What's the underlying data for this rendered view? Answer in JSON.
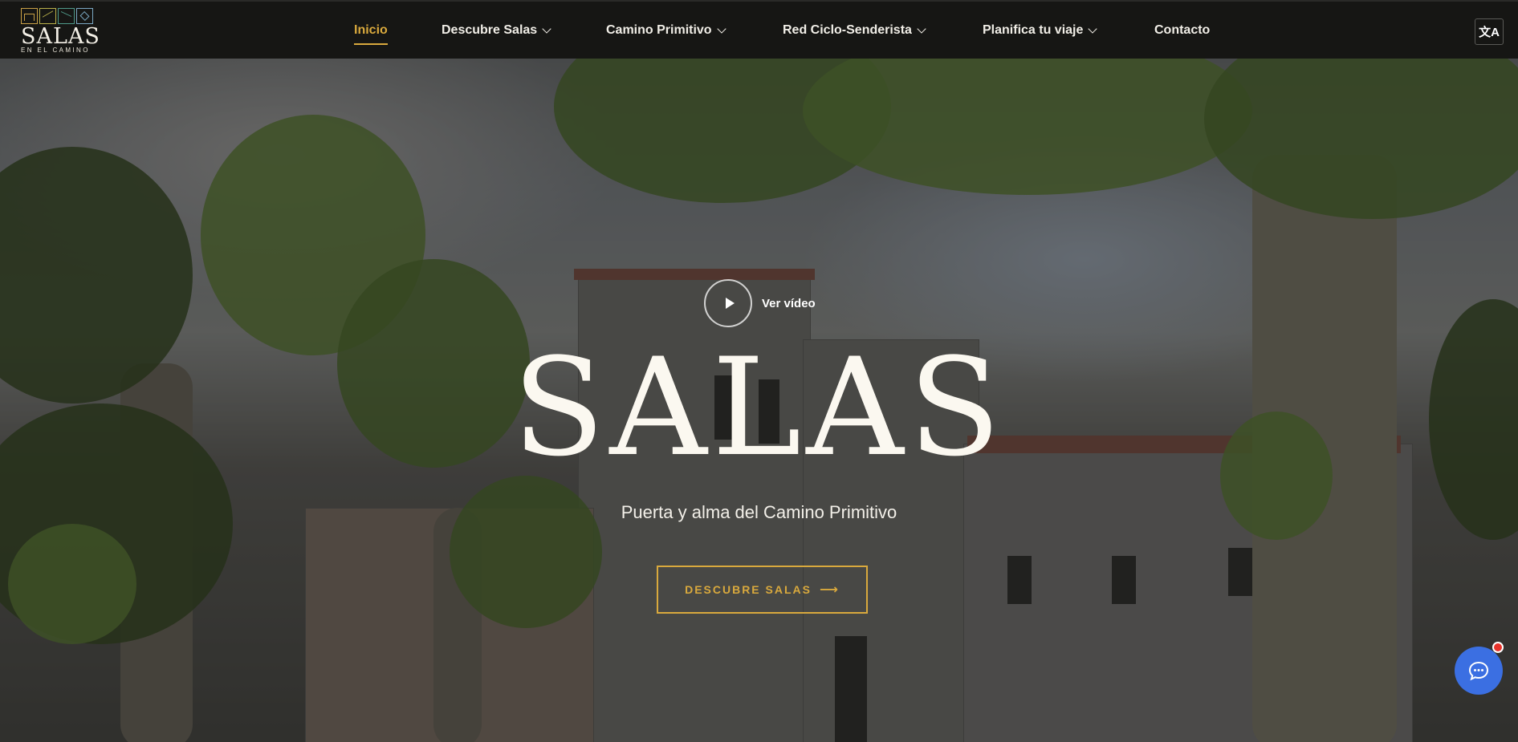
{
  "brand": {
    "name": "SALAS",
    "tagline": "EN EL CAMINO"
  },
  "nav": {
    "items": [
      {
        "label": "Inicio",
        "active": true,
        "has_dropdown": false
      },
      {
        "label": "Descubre Salas",
        "active": false,
        "has_dropdown": true
      },
      {
        "label": "Camino Primitivo",
        "active": false,
        "has_dropdown": true
      },
      {
        "label": "Red Ciclo-Senderista",
        "active": false,
        "has_dropdown": true
      },
      {
        "label": "Planifica tu viaje",
        "active": false,
        "has_dropdown": true
      },
      {
        "label": "Contacto",
        "active": false,
        "has_dropdown": false
      }
    ],
    "language_icon": "translate-icon",
    "language_glyph": "文A"
  },
  "hero": {
    "video_label": "Ver vídeo",
    "title": "SALAS",
    "subtitle": "Puerta y alma del Camino Primitivo",
    "cta_label": "DESCUBRE SALAS",
    "cta_arrow": "⟶"
  },
  "chat": {
    "icon": "chat-bubble-icon",
    "badge": "notification-dot"
  },
  "colors": {
    "accent": "#d9a93d",
    "header_bg": "#161614",
    "chat": "#3b6fe2",
    "badge": "#e8332b"
  }
}
